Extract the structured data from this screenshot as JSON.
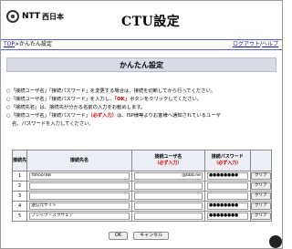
{
  "header": {
    "logo_text": "NTT",
    "logo_subtext": "西日本",
    "title": "CTU設定"
  },
  "breadcrumb": {
    "top": "TOP",
    "separator": ">",
    "current": "かんたん設定"
  },
  "nav": {
    "logout": "ログアウト",
    "slash": "/",
    "help": "ヘルプ"
  },
  "section": {
    "title": "かんたん設定"
  },
  "notes": {
    "n1": "○「接続ユーザ名」「接続パスワード」を変更する場合は、接続を切断してから行ってください。",
    "n2a": "○「接続ユーザ名」「接続パスワード」を入力し、",
    "n2b": "「OK」",
    "n2c": "ボタンをクリックしてください。",
    "n3": "○「接続先名」は、接続先が分かる名前の入力をお勧めします。",
    "n4a": "○「接続ユーザ名」「接続パスワード」",
    "n4b": "（必ず入力）",
    "n4c": "は、ISP様等よりお客様へ通知されているユーザ",
    "n5": "名、パスワードを入力してください。"
  },
  "table": {
    "headers": {
      "num": "接続先",
      "name": "接続先名",
      "user": "接続ユーザ名",
      "user_req": "（必ず入力）",
      "pass": "接続パスワード",
      "pass_req": "（必ず入力）"
    },
    "clear_label": "クリア",
    "rows": [
      {
        "num": "1",
        "name": "Yahoo!BB",
        "user": "@bbb.ne",
        "pass": "●●●●●●●●"
      },
      {
        "num": "2",
        "name": "",
        "user": "",
        "pass": ""
      },
      {
        "num": "3",
        "name": "",
        "user": "",
        "pass": ""
      },
      {
        "num": "4",
        "name": "送信元サイト",
        "user": "",
        "pass": "●●●●●●●●"
      },
      {
        "num": "5",
        "name": "フレッツ・スクウェア",
        "user": "",
        "pass": "●●●●●●●●"
      }
    ]
  },
  "buttons": {
    "ok": "OK",
    "cancel": "キャンセル"
  }
}
